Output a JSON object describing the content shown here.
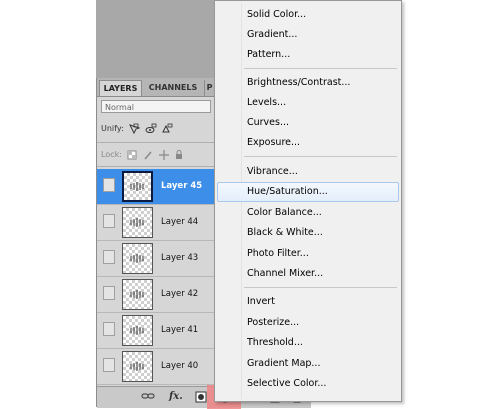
{
  "panel": {
    "tabs": [
      "LAYERS",
      "CHANNELS",
      "P"
    ],
    "blend_mode": "Normal",
    "unify_label": "Unify:",
    "lock_label": "Lock:",
    "layers": [
      {
        "name": "Layer 45",
        "selected": true
      },
      {
        "name": "Layer 44",
        "selected": false
      },
      {
        "name": "Layer 43",
        "selected": false
      },
      {
        "name": "Layer 42",
        "selected": false
      },
      {
        "name": "Layer 41",
        "selected": false
      },
      {
        "name": "Layer 40",
        "selected": false
      }
    ],
    "bottom_icons": [
      "link-layers-icon",
      "fx-icon",
      "layer-mask-icon",
      "adjustment-layer-icon",
      "new-group-icon",
      "new-layer-icon",
      "trash-icon"
    ],
    "fx_label": "fx."
  },
  "menu": {
    "groups": [
      [
        "Solid Color...",
        "Gradient...",
        "Pattern..."
      ],
      [
        "Brightness/Contrast...",
        "Levels...",
        "Curves...",
        "Exposure..."
      ],
      [
        "Vibrance...",
        "Hue/Saturation...",
        "Color Balance...",
        "Black & White...",
        "Photo Filter...",
        "Channel Mixer..."
      ],
      [
        "Invert",
        "Posterize...",
        "Threshold...",
        "Gradient Map...",
        "Selective Color..."
      ]
    ],
    "hovered": "Hue/Saturation..."
  },
  "colors": {
    "selection": "#3d8ee8",
    "highlight": "#f08585",
    "menu_bg": "#f0f0f0"
  }
}
